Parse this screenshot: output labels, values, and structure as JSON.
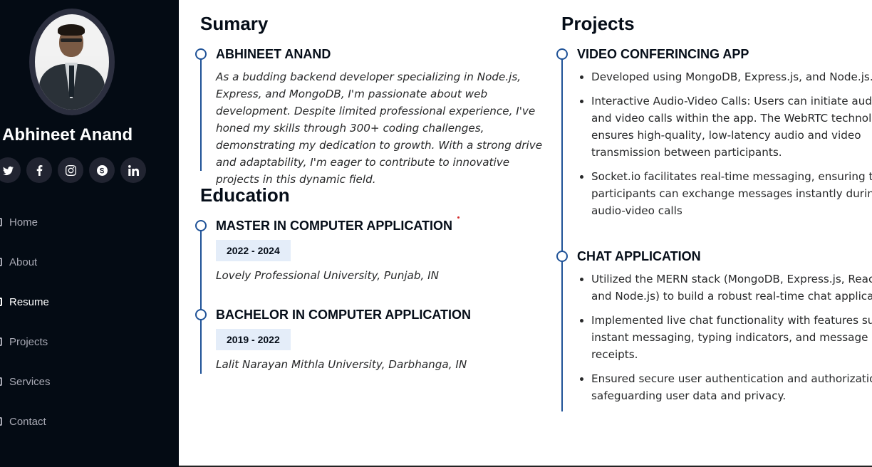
{
  "sidebar": {
    "name": "Abhineet Anand",
    "social": [
      "twitter-icon",
      "facebook-icon",
      "instagram-icon",
      "skype-icon",
      "linkedin-icon"
    ],
    "nav": [
      {
        "label": "Home",
        "icon": "home-icon",
        "active": false
      },
      {
        "label": "About",
        "icon": "person-icon",
        "active": false
      },
      {
        "label": "Resume",
        "icon": "file-icon",
        "active": true
      },
      {
        "label": "Projects",
        "icon": "book-icon",
        "active": false
      },
      {
        "label": "Services",
        "icon": "server-icon",
        "active": false
      },
      {
        "label": "Contact",
        "icon": "envelope-icon",
        "active": false
      }
    ]
  },
  "summary": {
    "heading": "Sumary",
    "title": "ABHINEET ANAND",
    "text": "As a budding backend developer specializing in Node.js, Express, and MongoDB, I'm passionate about web development. Despite limited professional experience, I've honed my skills through 300+ coding challenges, demonstrating my dedication to growth. With a strong drive and adaptability, I'm eager to contribute to innovative projects in this dynamic field."
  },
  "education": {
    "heading": "Education",
    "items": [
      {
        "title": "MASTER IN COMPUTER APPLICATION",
        "dates": "2022 - 2024",
        "institution": "Lovely Professional University, Punjab, IN"
      },
      {
        "title": "BACHELOR IN COMPUTER APPLICATION",
        "dates": "2019 - 2022",
        "institution": "Lalit Narayan Mithla University, Darbhanga, IN"
      }
    ]
  },
  "projects": {
    "heading": "Projects",
    "items": [
      {
        "title": "VIDEO CONFERINCING APP",
        "bullets": [
          "Developed using MongoDB, Express.js, and Node.js.",
          "Interactive Audio-Video Calls: Users can initiate audio and video calls within the app. The WebRTC technology ensures high-quality, low-latency audio and video transmission between participants.",
          "Socket.io facilitates real-time messaging, ensuring that participants can exchange messages instantly during audio-video calls"
        ]
      },
      {
        "title": "CHAT APPLICATION",
        "bullets": [
          "Utilized the MERN stack (MongoDB, Express.js, React, and Node.js) to build a robust real-time chat application.",
          "Implemented live chat functionality with features such as instant messaging, typing indicators, and message read receipts.",
          "Ensured secure user authentication and authorization, safeguarding user data and privacy."
        ]
      }
    ]
  },
  "colors": {
    "sidebar_bg": "#040b14",
    "accent": "#1f5297",
    "badge_bg": "#e4edf9"
  }
}
